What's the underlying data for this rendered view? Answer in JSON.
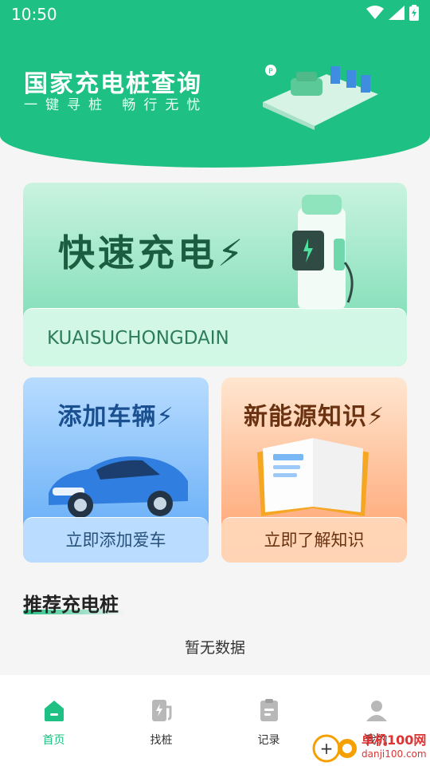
{
  "status_bar": {
    "time": "10:50"
  },
  "header": {
    "title": "国家充电桩查询",
    "subtitle": "一键寻桩 畅行无忧"
  },
  "fast_charge": {
    "title": "快速充电",
    "pill_text": "KUAISUCHONGDAIN"
  },
  "add_vehicle": {
    "title": "添加车辆",
    "button": "立即添加爱车"
  },
  "knowledge": {
    "title": "新能源知识",
    "button": "立即了解知识"
  },
  "recommend": {
    "title": "推荐充电桩",
    "empty": "暂无数据"
  },
  "tabs": [
    {
      "label": "首页",
      "icon": "home-icon",
      "active": true
    },
    {
      "label": "找桩",
      "icon": "charging-station-icon",
      "active": false
    },
    {
      "label": "记录",
      "icon": "record-icon",
      "active": false
    },
    {
      "label": "我的",
      "icon": "user-icon",
      "active": false
    }
  ],
  "watermark": {
    "line1": "单机100网",
    "line2": "danji100.com"
  },
  "colors": {
    "primary": "#1fc083",
    "car_blue": "#5aa7f5",
    "knowledge_orange": "#ff9f6a"
  }
}
